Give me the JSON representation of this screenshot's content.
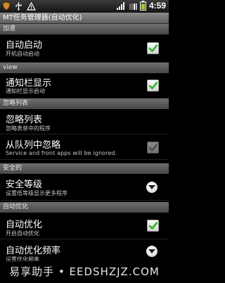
{
  "status_bar": {
    "time": "4:59",
    "left_icons": [
      "shield-icon",
      "usb-icon",
      "warning-icon"
    ],
    "right_icons": [
      "signal-icon",
      "wifi-icon",
      "battery-icon"
    ]
  },
  "title": "MT任务管理器(自动优化)",
  "sections": [
    {
      "header": "加速",
      "items": [
        {
          "title": "自动启动",
          "subtitle": "开机自动启动",
          "control": "checkbox",
          "checked": true
        }
      ]
    },
    {
      "header": "view",
      "items": [
        {
          "title": "通知栏显示",
          "subtitle": "通知栏显示启动",
          "control": "checkbox",
          "checked": true
        }
      ]
    },
    {
      "header": "忽略列表",
      "items": [
        {
          "title": "忽略列表",
          "subtitle": "忽略表单中的程序",
          "control": "none"
        },
        {
          "title": "从队列中忽略",
          "subtitle": "Service and front apps will be ignored.",
          "control": "checkbox",
          "checked": true,
          "disabled": true
        }
      ]
    },
    {
      "header": "安全的",
      "items": [
        {
          "title": "安全等级",
          "subtitle": "设置低等级显示更多程序",
          "control": "dropdown"
        }
      ]
    },
    {
      "header": "自动优化",
      "items": [
        {
          "title": "自动优化",
          "subtitle": "开启自动优化",
          "control": "checkbox",
          "checked": true
        },
        {
          "title": "自动优化频率",
          "subtitle": "设置优化频率",
          "control": "dropdown"
        }
      ]
    }
  ],
  "watermark": "易享助手 • EEDSHZJZ.COM"
}
